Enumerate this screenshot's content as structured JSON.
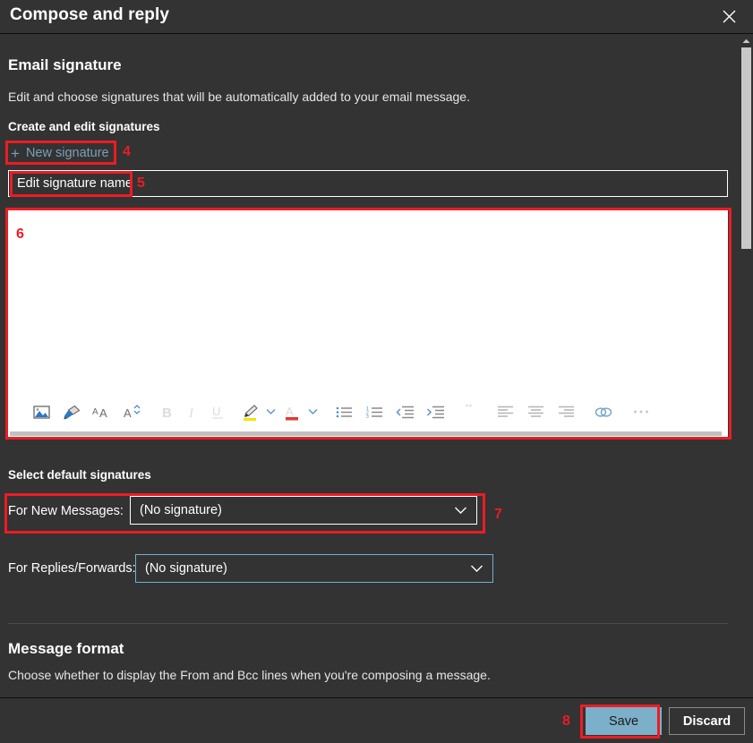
{
  "window": {
    "title": "Compose and reply",
    "close_icon": "close-x-icon"
  },
  "section": {
    "heading": "Email signature",
    "description": "Edit and choose signatures that will be automatically added to your email message.",
    "create_edit_label": "Create and edit signatures"
  },
  "new_signature": {
    "plus": "+",
    "label": "New signature",
    "color": "#7d9fb5"
  },
  "signature_name_input": {
    "value": "Edit signature name",
    "placeholder": "Edit signature name"
  },
  "editor": {
    "content": "",
    "toolbar": [
      {
        "name": "insert-picture-icon",
        "label": "Insert picture"
      },
      {
        "name": "format-painter-icon",
        "label": "Format painter"
      },
      {
        "name": "grow-font-icon",
        "label": "Grow font"
      },
      {
        "name": "shrink-font-icon",
        "label": "Shrink font"
      },
      {
        "name": "bold-icon",
        "label": "Bold"
      },
      {
        "name": "italic-icon",
        "label": "Italic"
      },
      {
        "name": "underline-icon",
        "label": "Underline"
      },
      {
        "name": "highlight-icon",
        "label": "Text highlight color"
      },
      {
        "name": "highlight-chevron-down-icon",
        "label": "Highlight options"
      },
      {
        "name": "font-color-icon",
        "label": "Font color"
      },
      {
        "name": "font-color-chevron-down-icon",
        "label": "Font color options"
      },
      {
        "name": "bulleted-list-icon",
        "label": "Bulleted list"
      },
      {
        "name": "numbered-list-icon",
        "label": "Numbered list"
      },
      {
        "name": "decrease-indent-icon",
        "label": "Decrease indent"
      },
      {
        "name": "increase-indent-icon",
        "label": "Increase indent"
      },
      {
        "name": "quote-icon",
        "label": "Quote"
      },
      {
        "name": "align-left-icon",
        "label": "Align left"
      },
      {
        "name": "align-center-icon",
        "label": "Align center"
      },
      {
        "name": "align-right-icon",
        "label": "Align right"
      },
      {
        "name": "insert-link-icon",
        "label": "Insert link"
      },
      {
        "name": "more-options-icon",
        "label": "More options"
      }
    ]
  },
  "default_signatures": {
    "heading": "Select default signatures",
    "new_messages": {
      "label": "For New Messages:",
      "value": "(No signature)"
    },
    "replies_forwards": {
      "label": "For Replies/Forwards:",
      "value": "(No signature)"
    }
  },
  "message_format": {
    "heading": "Message format",
    "description": "Choose whether to display the From and Bcc lines when you're composing a message."
  },
  "footer": {
    "save_label": "Save",
    "discard_label": "Discard",
    "save_bg": "#7cafc9"
  },
  "annotations": {
    "n4": "4",
    "n5": "5",
    "n6": "6",
    "n7": "7",
    "n8": "8",
    "color": "#ec1c24"
  }
}
